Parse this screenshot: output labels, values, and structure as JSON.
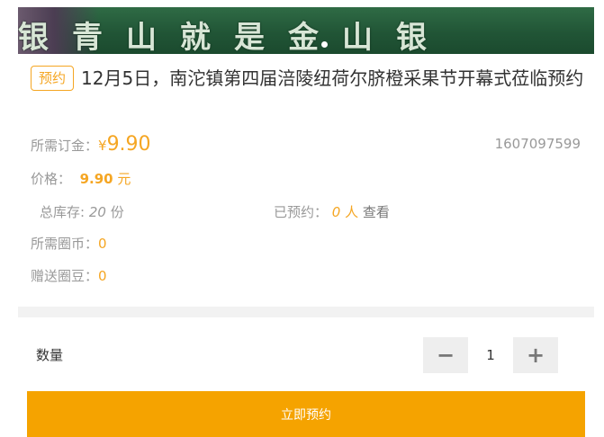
{
  "banner": {
    "text": "银青山就是金山银"
  },
  "product": {
    "tag": "预约",
    "title": "12月5日，南沱镇第四届涪陵纽荷尔脐橙采果节开幕式莅临预约",
    "deposit_label": "所需订金：",
    "deposit_currency": "¥",
    "deposit_value": "9.90",
    "phone": "1607097599",
    "price_label": "价格：",
    "price_value": "9.90",
    "price_unit": "元",
    "stock_label": "总库存:",
    "stock_value": "20",
    "stock_unit": "份",
    "reserved_label": "已预约：",
    "reserved_value": "0",
    "reserved_unit": "人",
    "view_link": "查看",
    "coins_label": "所需圈币：",
    "coins_value": "0",
    "beans_label": "赠送圈豆：",
    "beans_value": "0"
  },
  "quantity": {
    "label": "数量",
    "minus": "−",
    "value": "1",
    "plus": "+"
  },
  "submit": {
    "label": "立即预约"
  },
  "colors": {
    "accent": "#f5a623",
    "button": "#f5a300",
    "banner_green": "#215536"
  }
}
